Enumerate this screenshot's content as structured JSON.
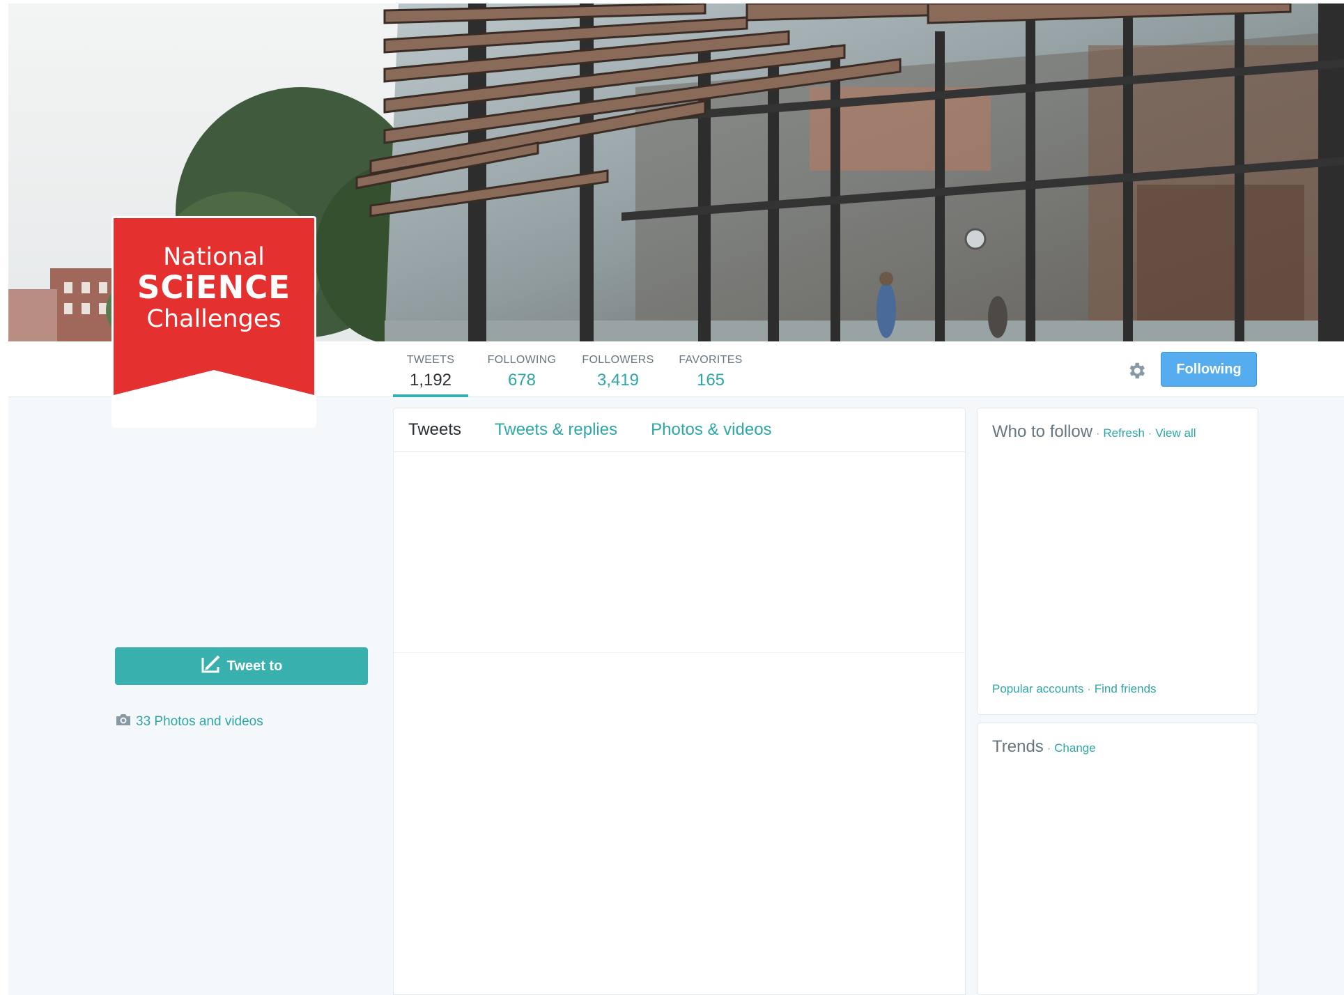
{
  "profile": {
    "logo": {
      "line1": "National",
      "line2": "SCiENCE",
      "line3": "Challenges",
      "brand_color": "#e4312f"
    }
  },
  "nav": {
    "stats": [
      {
        "label": "TWEETS",
        "value": "1,192",
        "active": true
      },
      {
        "label": "FOLLOWING",
        "value": "678",
        "active": false
      },
      {
        "label": "FOLLOWERS",
        "value": "3,419",
        "active": false
      },
      {
        "label": "FAVORITES",
        "value": "165",
        "active": false
      }
    ],
    "settings_icon": "gear-icon",
    "follow_button_label": "Following"
  },
  "sidebar": {
    "tweet_to_label": "Tweet to",
    "tweet_to_icon": "compose-icon",
    "photos_icon": "camera-icon",
    "photos_label": "33 Photos and videos"
  },
  "timeline": {
    "tabs": [
      {
        "label": "Tweets",
        "active": true
      },
      {
        "label": "Tweets & replies",
        "active": false
      },
      {
        "label": "Photos & videos",
        "active": false
      }
    ]
  },
  "who_to_follow": {
    "title": "Who to follow",
    "refresh": "Refresh",
    "view_all": "View all",
    "popular_accounts": "Popular accounts",
    "find_friends": "Find friends"
  },
  "trends": {
    "title": "Trends",
    "change": "Change"
  },
  "colors": {
    "accent": "#2ea6a8",
    "follow_blue": "#55acee",
    "tweet_button": "#38b1ae"
  }
}
